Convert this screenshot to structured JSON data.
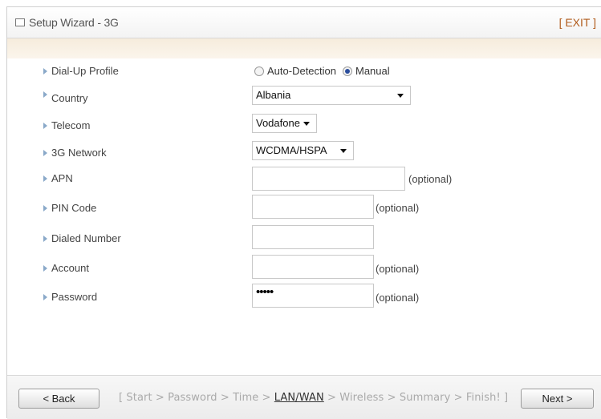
{
  "header": {
    "title": "Setup Wizard - 3G",
    "exit_label": "[ EXIT ]"
  },
  "form": {
    "dialup": {
      "label": "Dial-Up Profile",
      "options": [
        "Auto-Detection",
        "Manual"
      ],
      "selected": "Manual"
    },
    "country": {
      "label": "Country",
      "value": "Albania"
    },
    "telecom": {
      "label": "Telecom",
      "value": "Vodafone"
    },
    "network": {
      "label": "3G Network",
      "value": "WCDMA/HSPA"
    },
    "apn": {
      "label": "APN",
      "value": "",
      "note": "(optional)"
    },
    "pin": {
      "label": "PIN Code",
      "value": "",
      "note": "(optional)"
    },
    "dialed": {
      "label": "Dialed Number",
      "value": ""
    },
    "account": {
      "label": "Account",
      "value": "",
      "note": "(optional)"
    },
    "password": {
      "label": "Password",
      "value": "•••••",
      "note": "(optional)"
    }
  },
  "footer": {
    "back_label": "< Back",
    "next_label": "Next >",
    "steps": {
      "open": "[ Start > Password > Time > ",
      "current": "LAN/WAN",
      "close": " > Wireless > Summary > Finish! ]"
    }
  }
}
